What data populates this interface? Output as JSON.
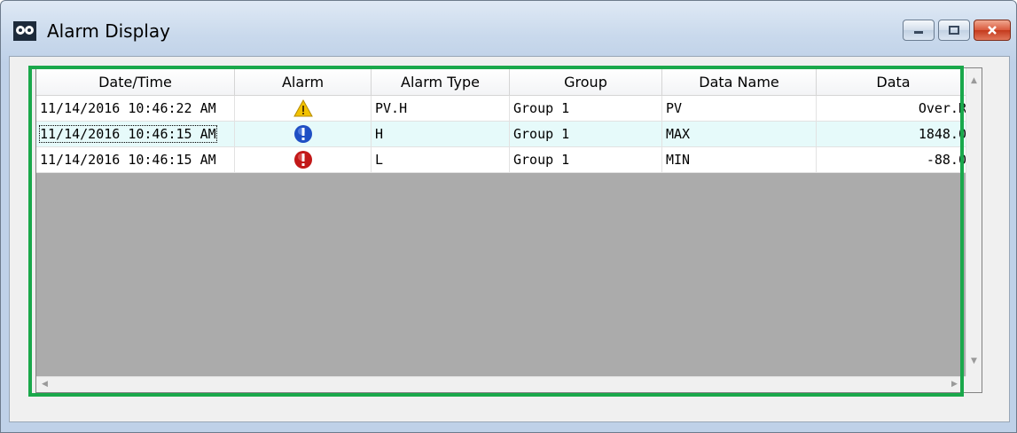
{
  "window": {
    "title": "Alarm Display",
    "buttons": [
      "minimize",
      "maximize",
      "close"
    ]
  },
  "grid": {
    "columns": [
      "Date/Time",
      "Alarm",
      "Alarm Type",
      "Group",
      "Data Name",
      "Data"
    ],
    "rows": [
      {
        "datetime": "11/14/2016 10:46:22 AM",
        "alarm_icon": "warning-icon",
        "alarm_type": "PV.H",
        "group": "Group 1",
        "data_name": "PV",
        "data": "Over.R"
      },
      {
        "datetime": "11/14/2016 10:46:15 AM",
        "alarm_icon": "info-icon",
        "alarm_type": "H",
        "group": "Group 1",
        "data_name": "MAX",
        "data": "1848.0"
      },
      {
        "datetime": "11/14/2016 10:46:15 AM",
        "alarm_icon": "error-icon",
        "alarm_type": "L",
        "group": "Group 1",
        "data_name": "MIN",
        "data": "-88.0"
      }
    ],
    "selected_row": 1
  },
  "colors": {
    "highlight_border": "#1aa84b",
    "grid_background": "#ababab",
    "selected_row": "#e6fafa",
    "warning": "#f2c200",
    "info": "#1f4fc4",
    "error": "#c21818"
  }
}
